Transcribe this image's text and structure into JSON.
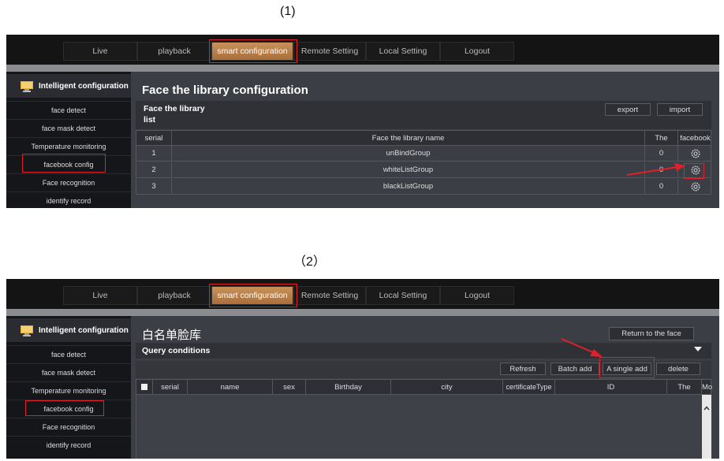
{
  "captions": {
    "first": "(1)",
    "second": "（2）"
  },
  "menu": {
    "items": [
      "Live",
      "playback",
      "smart configuration",
      "Remote Setting",
      "Local Setting",
      "Logout"
    ]
  },
  "sidebar": {
    "title": "Intelligent configuration",
    "items": [
      "face detect",
      "face mask detect",
      "Temperature monitoring",
      "facebook config",
      "Face recognition",
      "identify record"
    ]
  },
  "panel1": {
    "title": "Face the library configuration",
    "list_title_line1": "Face the library",
    "list_title_line2": "list",
    "export_label": "export",
    "import_label": "import",
    "columns": [
      "serial",
      "Face the library name",
      "The",
      "facebook"
    ],
    "rows": [
      {
        "serial": "1",
        "name": "unBindGroup",
        "count": "0"
      },
      {
        "serial": "2",
        "name": "whiteListGroup",
        "count": "0"
      },
      {
        "serial": "3",
        "name": "blackListGroup",
        "count": "0"
      }
    ]
  },
  "panel2": {
    "title": "白名单脸库",
    "return_label": "Return to the face",
    "query_label": "Query conditions",
    "buttons": [
      "Refresh",
      "Batch add",
      "A single add",
      "delete"
    ],
    "columns": [
      "serial",
      "name",
      "sex",
      "Birthday",
      "city",
      "certificateType",
      "ID",
      "The",
      "Mo"
    ]
  },
  "colors": {
    "accent": "#c08050",
    "highlight": "#e0202a",
    "panel": "#3c3e46"
  }
}
